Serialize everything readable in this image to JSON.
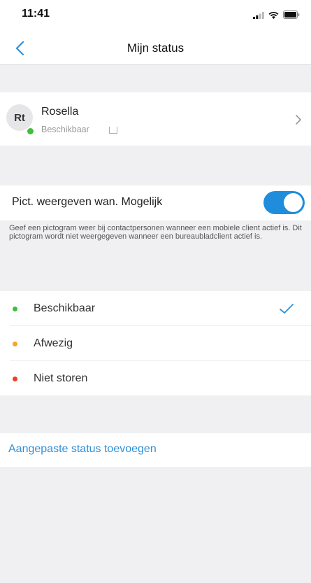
{
  "status_bar": {
    "time": "11:41"
  },
  "nav": {
    "title": "Mijn status"
  },
  "profile": {
    "initials": "Rt",
    "name": "Rosella",
    "status": "Beschikbaar",
    "status_color": "#3dbf3d"
  },
  "toggle_setting": {
    "label": "Pict. weergeven wan. Mogelijk",
    "enabled": true,
    "description": "Geef een pictogram weer bij contactpersonen wanneer een mobiele client actief is. Dit pictogram wordt niet weergegeven wanneer een bureaubladclient actief is."
  },
  "statuses": [
    {
      "label": "Beschikbaar",
      "color": "#3dbf3d",
      "selected": true
    },
    {
      "label": "Afwezig",
      "color": "#f5a623",
      "selected": false
    },
    {
      "label": "Niet storen",
      "color": "#e8412a",
      "selected": false
    }
  ],
  "custom_status": {
    "label": "Aangepaste status toevoegen"
  },
  "colors": {
    "accent": "#1f8ddb",
    "link": "#2f8fd8"
  }
}
